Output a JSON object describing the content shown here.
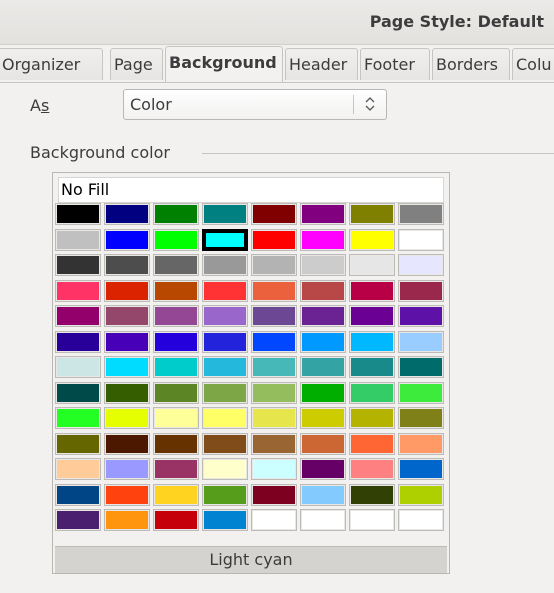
{
  "window": {
    "title": "Page Style: Default"
  },
  "tabs": [
    {
      "label": "Organizer"
    },
    {
      "label": "Page"
    },
    {
      "label": "Background"
    },
    {
      "label": "Header"
    },
    {
      "label": "Footer"
    },
    {
      "label": "Borders"
    },
    {
      "label": "Colu"
    }
  ],
  "active_tab": "Background",
  "as_field": {
    "label_prefix": "A",
    "label_mnemonic": "s",
    "value": "Color"
  },
  "background_color": {
    "section_label": "Background color",
    "no_fill_label": "No Fill",
    "selected_color_name": "Light cyan",
    "selected_index": 11,
    "palette": [
      "#000000",
      "#000080",
      "#008000",
      "#008080",
      "#800000",
      "#800080",
      "#808000",
      "#808080",
      "#c0c0c0",
      "#0000ff",
      "#00ff00",
      "#00ffff",
      "#ff0000",
      "#ff00ff",
      "#ffff00",
      "#ffffff",
      "#333333",
      "#4d4d4d",
      "#666666",
      "#999999",
      "#b3b3b3",
      "#cccccc",
      "#e6e6e6",
      "#e6e6ff",
      "#ff3366",
      "#dc2300",
      "#b84700",
      "#ff3333",
      "#eb613d",
      "#b84747",
      "#b80047",
      "#99284c",
      "#94006b",
      "#94476b",
      "#944794",
      "#9966cc",
      "#6b4794",
      "#6b2394",
      "#6b0094",
      "#5e11a6",
      "#280099",
      "#4700b8",
      "#2300dc",
      "#2323dc",
      "#0047ff",
      "#0099ff",
      "#00b8ff",
      "#99ccff",
      "#cce6e6",
      "#00dcff",
      "#00cccc",
      "#23b8dc",
      "#47b8b8",
      "#33a3a3",
      "#198a8a",
      "#006b6b",
      "#004a4a",
      "#355e00",
      "#5c8526",
      "#7da647",
      "#94bd5e",
      "#00ae00",
      "#33cc66",
      "#3deb3d",
      "#23ff23",
      "#e6ff00",
      "#ffff99",
      "#ffff66",
      "#e6e64c",
      "#cccc00",
      "#b3b300",
      "#808019",
      "#666600",
      "#4c1900",
      "#663300",
      "#804c19",
      "#996633",
      "#cc6633",
      "#ff6633",
      "#ff9966",
      "#ffcc99",
      "#9999ff",
      "#993366",
      "#ffffcc",
      "#ccffff",
      "#660066",
      "#ff8080",
      "#0066cc",
      "#004586",
      "#ff420e",
      "#ffd320",
      "#579d1c",
      "#7e0021",
      "#83caff",
      "#314004",
      "#aecf00",
      "#4b1f6f",
      "#ff950e",
      "#c5000b",
      "#0084d1",
      "#ffffff",
      "#ffffff",
      "#ffffff",
      "#ffffff"
    ]
  }
}
